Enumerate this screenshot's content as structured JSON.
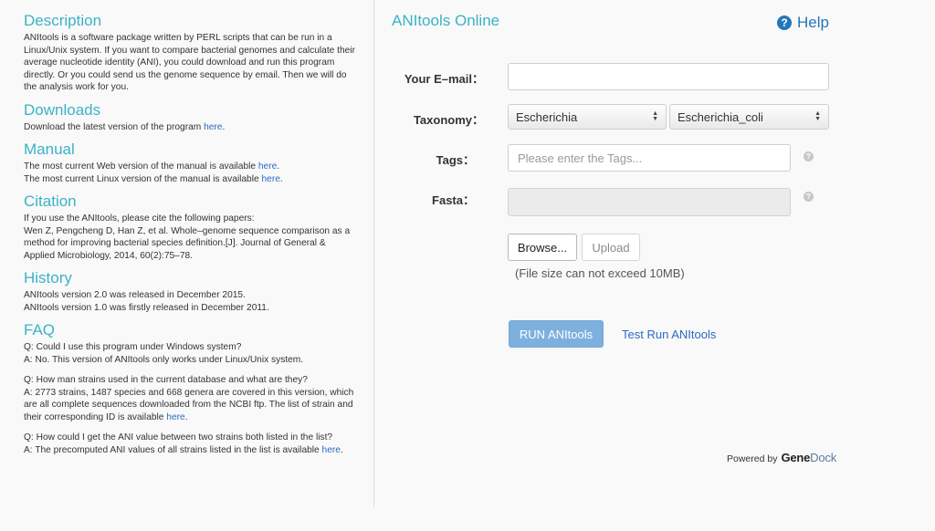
{
  "left": {
    "description": {
      "title": "Description",
      "text": "ANItools is a software package written by PERL scripts that can be run in a Linux/Unix system. If you want to compare bacterial genomes and calculate their average nucleotide identity (ANI), you could download and run this program directly. Or you could send us the genome sequence by email. Then we will do the analysis work for you."
    },
    "downloads": {
      "title": "Downloads",
      "text": "Download the latest version of the program ",
      "link": "here",
      "tail": "."
    },
    "manual": {
      "title": "Manual",
      "line1": "The most current Web version of the manual is available ",
      "line1_link": "here",
      "line1_tail": ".",
      "line2": "The most current Linux version of the manual is available ",
      "line2_link": "here",
      "line2_tail": "."
    },
    "citation": {
      "title": "Citation",
      "intro": "If you use the ANItools, please cite the following papers:",
      "ref": "Wen Z, Pengcheng D, Han Z, et al. Whole–genome sequence comparison as a method for improving bacterial species definition.[J]. Journal of General & Applied Microbiology, 2014, 60(2):75–78."
    },
    "history": {
      "title": "History",
      "line1": "ANItools version 2.0 was released in December 2015.",
      "line2": "ANItools version 1.0 was firstly released in December 2011."
    },
    "faq": {
      "title": "FAQ",
      "q1": "Q: Could I use this program under Windows system?",
      "a1": "A: No. This version of ANItools only works under Linux/Unix system.",
      "q2": "Q: How man strains used in the current database and what are they?",
      "a2": "A: 2773 strains, 1487 species and 668 genera are covered in this version, which are all complete sequences downloaded from the NCBI ftp. The list of strain and their corresponding ID is available ",
      "a2_link": "here",
      "a2_tail": ".",
      "q3": "Q: How could I get the ANI value between two strains both listed in the list?",
      "a3": "A: The precomputed ANI values of all strains listed in the list is available ",
      "a3_link": "here",
      "a3_tail": "."
    }
  },
  "right": {
    "title": "ANItools Online",
    "help": "Help",
    "email_label": "Your E–mail：",
    "email_value": "",
    "taxonomy_label": "Taxonomy：",
    "genus": "Escherichia",
    "species": "Escherichia_coli",
    "tags_label": "Tags：",
    "tags_placeholder": "Please enter the Tags...",
    "fasta_label": "Fasta：",
    "browse": "Browse...",
    "upload": "Upload",
    "size_hint": "(File size can not exceed 10MB)",
    "run": "RUN ANItools",
    "test_run": "Test Run ANItools",
    "powered_by": "Powered by",
    "brand_gene": "Gene",
    "brand_dock": "Dock"
  },
  "colors": {
    "accent": "#3bb2c8",
    "link": "#2a6bbf",
    "run_button": "#7eb0de"
  }
}
